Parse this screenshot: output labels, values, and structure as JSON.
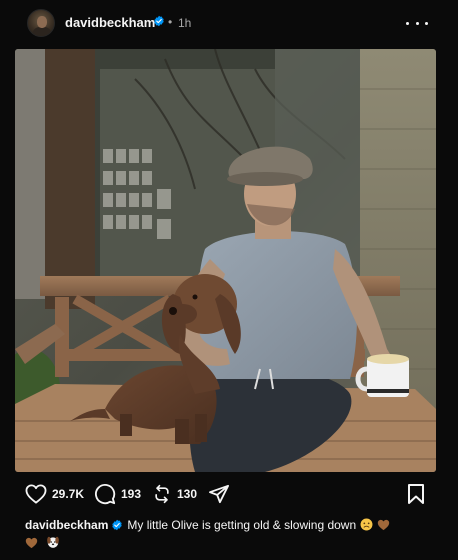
{
  "post": {
    "author": "davidbeckham",
    "separator": "•",
    "time": "1h",
    "verified_color": "#0095f6"
  },
  "photo": {
    "description_icon": "post-photo"
  },
  "actions": {
    "likes": "29.7K",
    "comments": "193",
    "reposts": "130"
  },
  "caption": {
    "user": "davidbeckham",
    "text": "My little Olive is getting old & slowing down"
  },
  "colors": {
    "background": "#0a0a0a",
    "text": "#f5f5f5",
    "muted": "#a8a8a8",
    "heart_emoji": "#a0683a"
  }
}
